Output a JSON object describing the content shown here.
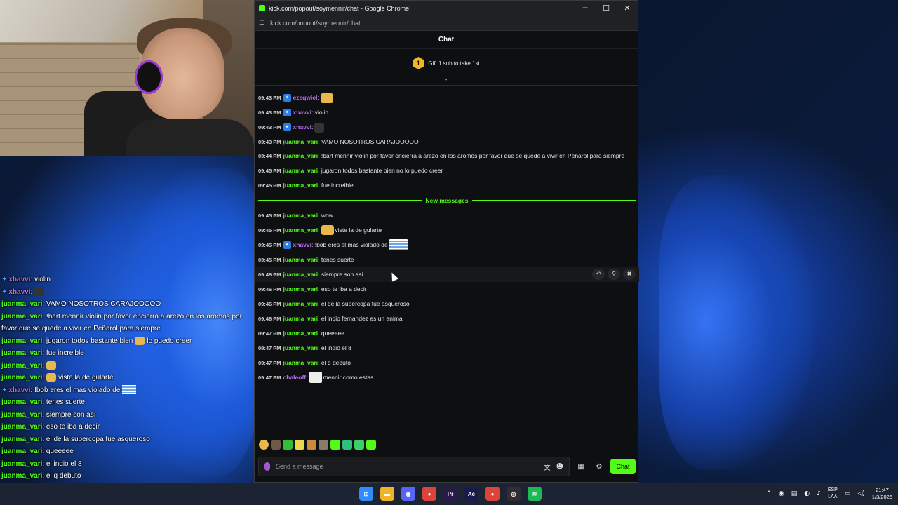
{
  "window": {
    "title": "kick.com/popout/soymennir/chat - Google Chrome",
    "url": "kick.com/popout/soymennir/chat",
    "minimize_glyph": "─",
    "maximize_glyph": "☐",
    "close_glyph": "✕"
  },
  "chat": {
    "header": "Chat",
    "gift_rank": "1",
    "gift_text": "Gift 1 sub to take 1st",
    "new_messages_label": "New messages",
    "input_placeholder": "Send a message",
    "send_label": "Chat",
    "accent_color": "#53fc18",
    "messages_before": [
      {
        "time": "09:43 PM",
        "user": "ezeqwiel",
        "color": "#b56cf0",
        "badge": true,
        "text": ":",
        "emote": "emote-face"
      },
      {
        "time": "09:43 PM",
        "user": "xhavvi",
        "color": "#b56cf0",
        "badge": true,
        "text": ": violin"
      },
      {
        "time": "09:43 PM",
        "user": "xhavvi",
        "color": "#b56cf0",
        "badge": true,
        "text": ":",
        "emote": "emote-dark"
      },
      {
        "time": "09:43 PM",
        "user": "juanma_vari",
        "color": "#53fc18",
        "badge": false,
        "text": ": VAMO NOSOTROS CARAJOOOOO"
      },
      {
        "time": "09:44 PM",
        "user": "juanma_vari",
        "color": "#53fc18",
        "badge": false,
        "text": ": !bart mennir violin por favor encierra a arezo en los aromos por favor que se quede a vivir en Peñarol para siempre",
        "multi": true
      },
      {
        "time": "09:45 PM",
        "user": "juanma_vari",
        "color": "#53fc18",
        "badge": false,
        "text": ": jugaron todos bastante bien no lo puedo creer"
      },
      {
        "time": "09:45 PM",
        "user": "juanma_vari",
        "color": "#53fc18",
        "badge": false,
        "text": ": fue increible"
      }
    ],
    "messages_after": [
      {
        "time": "09:45 PM",
        "user": "juanma_vari",
        "color": "#53fc18",
        "text": ": wow"
      },
      {
        "time": "09:45 PM",
        "user": "juanma_vari",
        "color": "#53fc18",
        "text": ":",
        "emote": "emote-yellow",
        "text2": "viste la de gularte"
      },
      {
        "time": "09:45 PM",
        "user": "xhavvi",
        "color": "#b56cf0",
        "badge": true,
        "text": ": !bob eres el mas violado de",
        "emote": "flag"
      },
      {
        "time": "09:45 PM",
        "user": "juanma_vari",
        "color": "#53fc18",
        "text": ": tenes suerte"
      },
      {
        "time": "09:46 PM",
        "user": "juanma_vari",
        "color": "#53fc18",
        "text": ": siempre son así",
        "hover": true
      },
      {
        "time": "09:46 PM",
        "user": "juanma_vari",
        "color": "#53fc18",
        "text": ": eso te iba a decir"
      },
      {
        "time": "09:46 PM",
        "user": "juanma_vari",
        "color": "#53fc18",
        "text": ": el de la supercopa fue asqueroso"
      },
      {
        "time": "09:46 PM",
        "user": "juanma_vari",
        "color": "#53fc18",
        "text": ": el indio fernandez es un animal"
      },
      {
        "time": "09:47 PM",
        "user": "juanma_vari",
        "color": "#53fc18",
        "text": ": queeeee"
      },
      {
        "time": "09:47 PM",
        "user": "juanma_vari",
        "color": "#53fc18",
        "text": ": el indio el 8"
      },
      {
        "time": "09:47 PM",
        "user": "juanma_vari",
        "color": "#53fc18",
        "text": ": el q debuto"
      },
      {
        "time": "09:47 PM",
        "user": "chaleoff",
        "color": "#b56cf0",
        "text": ":",
        "emote": "avatar",
        "text2": "mennir como estas"
      }
    ]
  },
  "overlay": {
    "lines": [
      {
        "user": "xhavvi",
        "color": "#b56cf0",
        "text": ": violin",
        "badge": true
      },
      {
        "user": "xhavvi",
        "color": "#b56cf0",
        "text": ":",
        "badge": true,
        "emote": "dark"
      },
      {
        "user": "juanma_vari",
        "color": "#53fc18",
        "text": ": VAMO NOSOTROS CARAJOOOOO"
      },
      {
        "user": "juanma_vari",
        "color": "#53fc18",
        "text": ": !bart mennir violin por favor encierra a arezo en los aromos por favor que se quede a vivir en Peñarol para siempre",
        "wrap": true
      },
      {
        "user": "juanma_vari",
        "color": "#53fc18",
        "text": ": jugaron todos bastante bien",
        "emote": "yellow",
        "text2": "lo puedo creer"
      },
      {
        "user": "juanma_vari",
        "color": "#53fc18",
        "text": ": fue increible"
      },
      {
        "user": "juanma_vari",
        "color": "#53fc18",
        "text": ":",
        "emote": "yellow"
      },
      {
        "user": "juanma_vari",
        "color": "#53fc18",
        "text": ":",
        "emote": "yellow",
        "text2": "viste la de gularte"
      },
      {
        "user": "xhavvi",
        "color": "#b56cf0",
        "text": ": !bob eres el mas violado de",
        "badge": true,
        "emote": "flag"
      },
      {
        "user": "juanma_vari",
        "color": "#53fc18",
        "text": ": tenes suerte"
      },
      {
        "user": "juanma_vari",
        "color": "#53fc18",
        "text": ": siempre son así"
      },
      {
        "user": "juanma_vari",
        "color": "#53fc18",
        "text": ": eso te iba a decir"
      },
      {
        "user": "juanma_vari",
        "color": "#53fc18",
        "text": ": el de la supercopa fue asqueroso"
      },
      {
        "user": "juanma_vari",
        "color": "#53fc18",
        "text": ": queeeee"
      },
      {
        "user": "juanma_vari",
        "color": "#53fc18",
        "text": ": el indio el 8"
      },
      {
        "user": "juanma_vari",
        "color": "#53fc18",
        "text": ": el q debuto"
      },
      {
        "user": "chaleoff",
        "color": "#b56cf0",
        "text": ":",
        "emote": "avatar",
        "text2": "mennir como estas"
      }
    ]
  },
  "taskbar": {
    "apps": [
      {
        "name": "windows-start-icon",
        "color": "#2f8cff",
        "glyph": "⊞"
      },
      {
        "name": "file-explorer-icon",
        "color": "#f0b429",
        "glyph": "▬"
      },
      {
        "name": "discord-icon",
        "color": "#5865f2",
        "glyph": "◉"
      },
      {
        "name": "chrome-icon",
        "color": "#db4437",
        "glyph": "●"
      },
      {
        "name": "premiere-icon",
        "color": "#2a1a4a",
        "glyph": "Pr"
      },
      {
        "name": "after-effects-icon",
        "color": "#1a1a4a",
        "glyph": "Ae"
      },
      {
        "name": "chrome-active-icon",
        "color": "#db4437",
        "glyph": "●"
      },
      {
        "name": "obs-icon",
        "color": "#302e31",
        "glyph": "◎"
      },
      {
        "name": "spotify-icon",
        "color": "#1db954",
        "glyph": "≋"
      }
    ],
    "tray_lang_1": "ESP",
    "tray_lang_2": "LAA",
    "time": "21:47",
    "date": "1/3/2026"
  }
}
